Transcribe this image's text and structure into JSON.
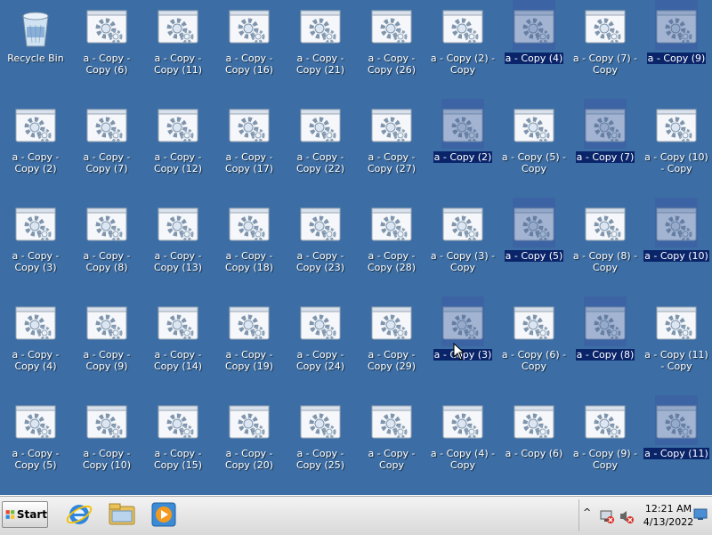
{
  "colors": {
    "desktop": "#3c6ea5",
    "selection": "#0a246a",
    "taskbar": "#e4e4e4"
  },
  "desktop": {
    "icons": [
      {
        "label": "Recycle Bin",
        "kind": "recycle-bin-icon",
        "selected": false
      },
      {
        "label": "a - Copy - Copy (6)",
        "kind": "file-icon",
        "selected": false
      },
      {
        "label": "a - Copy - Copy (11)",
        "kind": "file-icon",
        "selected": false
      },
      {
        "label": "a - Copy - Copy (16)",
        "kind": "file-icon",
        "selected": false
      },
      {
        "label": "a - Copy - Copy (21)",
        "kind": "file-icon",
        "selected": false
      },
      {
        "label": "a - Copy - Copy (26)",
        "kind": "file-icon",
        "selected": false
      },
      {
        "label": "a - Copy (2) - Copy",
        "kind": "file-icon",
        "selected": false
      },
      {
        "label": "a - Copy (4)",
        "kind": "file-icon",
        "selected": true
      },
      {
        "label": "a - Copy (7) - Copy",
        "kind": "file-icon",
        "selected": false
      },
      {
        "label": "a - Copy (9)",
        "kind": "file-icon",
        "selected": true
      },
      {
        "label": "a - Copy - Copy (2)",
        "kind": "file-icon",
        "selected": false
      },
      {
        "label": "a - Copy - Copy (7)",
        "kind": "file-icon",
        "selected": false
      },
      {
        "label": "a - Copy - Copy (12)",
        "kind": "file-icon",
        "selected": false
      },
      {
        "label": "a - Copy - Copy (17)",
        "kind": "file-icon",
        "selected": false
      },
      {
        "label": "a - Copy - Copy (22)",
        "kind": "file-icon",
        "selected": false
      },
      {
        "label": "a - Copy - Copy (27)",
        "kind": "file-icon",
        "selected": false
      },
      {
        "label": "a - Copy (2)",
        "kind": "file-icon",
        "selected": true
      },
      {
        "label": "a - Copy (5) - Copy",
        "kind": "file-icon",
        "selected": false
      },
      {
        "label": "a - Copy (7)",
        "kind": "file-icon",
        "selected": true
      },
      {
        "label": "a - Copy (10) - Copy",
        "kind": "file-icon",
        "selected": false
      },
      {
        "label": "a - Copy - Copy (3)",
        "kind": "file-icon",
        "selected": false
      },
      {
        "label": "a - Copy - Copy (8)",
        "kind": "file-icon",
        "selected": false
      },
      {
        "label": "a - Copy - Copy (13)",
        "kind": "file-icon",
        "selected": false
      },
      {
        "label": "a - Copy - Copy (18)",
        "kind": "file-icon",
        "selected": false
      },
      {
        "label": "a - Copy - Copy (23)",
        "kind": "file-icon",
        "selected": false
      },
      {
        "label": "a - Copy - Copy (28)",
        "kind": "file-icon",
        "selected": false
      },
      {
        "label": "a - Copy (3) - Copy",
        "kind": "file-icon",
        "selected": false
      },
      {
        "label": "a - Copy (5)",
        "kind": "file-icon",
        "selected": true
      },
      {
        "label": "a - Copy (8) - Copy",
        "kind": "file-icon",
        "selected": false
      },
      {
        "label": "a - Copy (10)",
        "kind": "file-icon",
        "selected": true
      },
      {
        "label": "a - Copy - Copy (4)",
        "kind": "file-icon",
        "selected": false
      },
      {
        "label": "a - Copy - Copy (9)",
        "kind": "file-icon",
        "selected": false
      },
      {
        "label": "a - Copy - Copy (14)",
        "kind": "file-icon",
        "selected": false
      },
      {
        "label": "a - Copy - Copy (19)",
        "kind": "file-icon",
        "selected": false
      },
      {
        "label": "a - Copy - Copy (24)",
        "kind": "file-icon",
        "selected": false
      },
      {
        "label": "a - Copy - Copy (29)",
        "kind": "file-icon",
        "selected": false
      },
      {
        "label": "a - Copy (3)",
        "kind": "file-icon",
        "selected": true
      },
      {
        "label": "a - Copy (6) - Copy",
        "kind": "file-icon",
        "selected": false
      },
      {
        "label": "a - Copy (8)",
        "kind": "file-icon",
        "selected": true
      },
      {
        "label": "a - Copy (11) - Copy",
        "kind": "file-icon",
        "selected": false
      },
      {
        "label": "a - Copy - Copy (5)",
        "kind": "file-icon",
        "selected": false
      },
      {
        "label": "a - Copy - Copy (10)",
        "kind": "file-icon",
        "selected": false
      },
      {
        "label": "a - Copy - Copy (15)",
        "kind": "file-icon",
        "selected": false
      },
      {
        "label": "a - Copy - Copy (20)",
        "kind": "file-icon",
        "selected": false
      },
      {
        "label": "a - Copy - Copy (25)",
        "kind": "file-icon",
        "selected": false
      },
      {
        "label": "a - Copy - Copy",
        "kind": "file-icon",
        "selected": false
      },
      {
        "label": "a - Copy (4) - Copy",
        "kind": "file-icon",
        "selected": false
      },
      {
        "label": "a - Copy (6)",
        "kind": "file-icon",
        "selected": false
      },
      {
        "label": "a - Copy (9) - Copy",
        "kind": "file-icon",
        "selected": false
      },
      {
        "label": "a - Copy (11)",
        "kind": "file-icon",
        "selected": true
      }
    ]
  },
  "taskbar": {
    "start_label": "Start",
    "pinned": [
      "internet-explorer-icon",
      "windows-explorer-icon",
      "media-player-icon"
    ],
    "tray": {
      "icons": [
        "show-hidden-icons-chevron",
        "network-icon",
        "volume-muted-icon",
        "show-desktop-icon"
      ],
      "time": "12:21 AM",
      "date": "4/13/2022"
    }
  }
}
